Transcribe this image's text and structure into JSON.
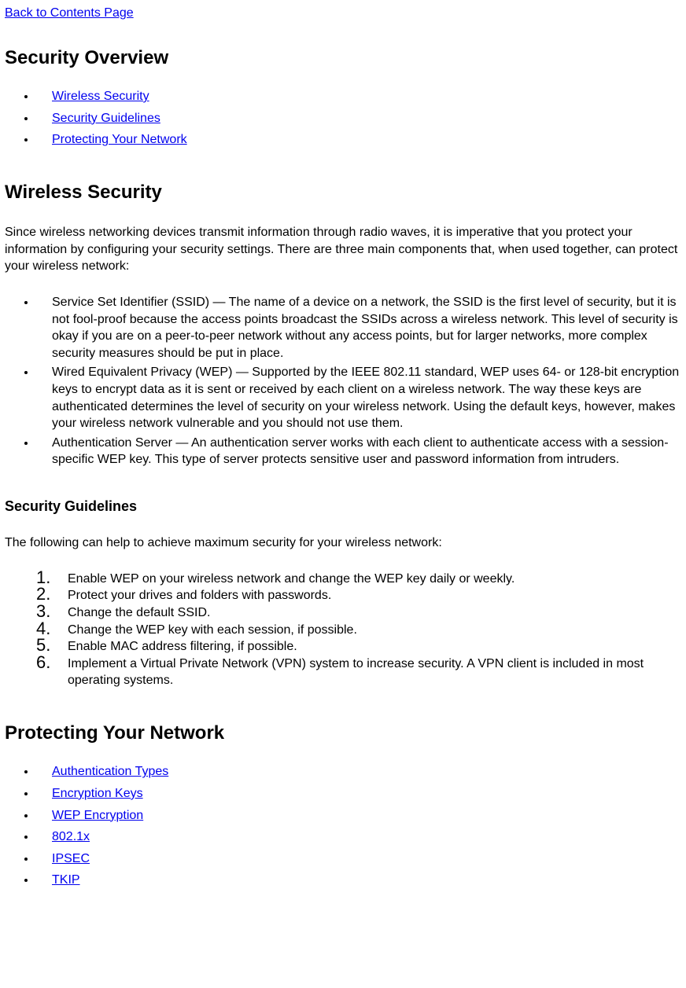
{
  "topLink": "Back to Contents Page",
  "title": "Security Overview",
  "tocLinks": [
    "Wireless Security",
    "Security Guidelines",
    "Protecting Your Network"
  ],
  "wireless": {
    "heading": "Wireless Security",
    "intro": "Since wireless networking devices transmit information through radio waves, it is imperative that you protect your information by configuring your security settings. There are three main components that, when used together, can protect your wireless network:",
    "items": [
      "Service Set Identifier (SSID) — The name of a device on a network, the SSID is the first level of security, but it is not fool-proof because the access points broadcast the SSIDs across a wireless network. This level of security is okay if you are on a peer-to-peer network without any access points, but for larger networks, more complex security measures should be put in place.",
      "Wired Equivalent Privacy (WEP) — Supported by the IEEE 802.11 standard, WEP uses 64- or 128-bit encryption keys to encrypt data as it is sent or received by each client on a wireless network. The way these keys are authenticated determines the level of security on your wireless network. Using the default keys, however, makes your wireless network vulnerable and you should not use them.",
      "Authentication Server — An authentication server works with each client to authenticate access with a session-specific WEP key. This type of server protects sensitive user and password information from intruders."
    ]
  },
  "guidelines": {
    "heading": "Security Guidelines",
    "intro": "The following can help to achieve maximum security for your wireless network:",
    "items": [
      "Enable WEP on your wireless network and change the WEP key daily or weekly.",
      "Protect your drives and folders with passwords.",
      "Change the default SSID.",
      "Change the WEP key with each session, if possible.",
      "Enable MAC address filtering, if possible.",
      "Implement a Virtual Private Network (VPN) system to increase security. A VPN client is included in most operating systems."
    ]
  },
  "protecting": {
    "heading": "Protecting Your Network",
    "links": [
      "Authentication Types",
      "Encryption Keys",
      "WEP Encryption",
      "802.1x",
      "IPSEC",
      "TKIP"
    ]
  }
}
